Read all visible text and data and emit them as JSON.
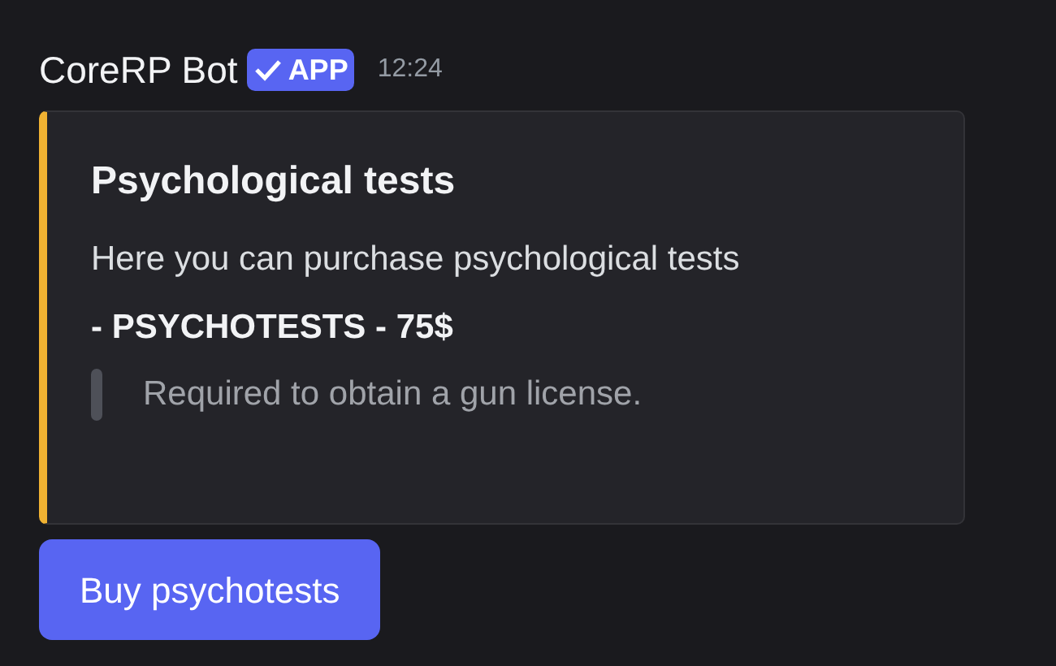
{
  "message": {
    "author": "CoreRP Bot",
    "badge": "APP",
    "time": "12:24"
  },
  "embed": {
    "title": "Psychological tests",
    "description": "Here you can purchase psychological tests",
    "heading": "- PSYCHOTESTS - 75$",
    "quote": "Required to obtain a gun license."
  },
  "buttons": [
    {
      "label": "Buy psychotests"
    }
  ]
}
